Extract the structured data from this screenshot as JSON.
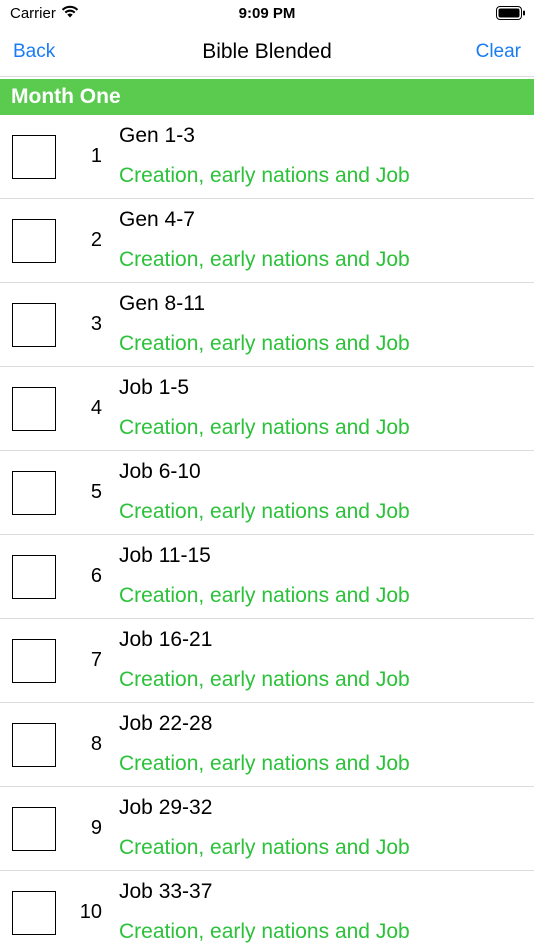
{
  "status": {
    "carrier": "Carrier",
    "time": "9:09 PM",
    "wifi_icon": "wifi-icon",
    "battery_icon": "battery-icon"
  },
  "nav": {
    "back_label": "Back",
    "title": "Bible Blended",
    "clear_label": "Clear"
  },
  "colors": {
    "accent": "#1a7cf5",
    "header_green": "#5bcb50",
    "subtitle_green": "#2bc23a"
  },
  "section": {
    "title": "Month One"
  },
  "readings": [
    {
      "day": "1",
      "ref": "Gen 1-3",
      "desc": "Creation, early nations and Job"
    },
    {
      "day": "2",
      "ref": "Gen 4-7",
      "desc": "Creation, early nations and Job"
    },
    {
      "day": "3",
      "ref": "Gen 8-11",
      "desc": "Creation, early nations and Job"
    },
    {
      "day": "4",
      "ref": "Job 1-5",
      "desc": "Creation, early nations and Job"
    },
    {
      "day": "5",
      "ref": "Job 6-10",
      "desc": "Creation, early nations and Job"
    },
    {
      "day": "6",
      "ref": "Job 11-15",
      "desc": "Creation, early nations and Job"
    },
    {
      "day": "7",
      "ref": "Job 16-21",
      "desc": "Creation, early nations and Job"
    },
    {
      "day": "8",
      "ref": "Job 22-28",
      "desc": "Creation, early nations and Job"
    },
    {
      "day": "9",
      "ref": "Job 29-32",
      "desc": "Creation, early nations and Job"
    },
    {
      "day": "10",
      "ref": "Job 33-37",
      "desc": "Creation, early nations and Job"
    }
  ]
}
